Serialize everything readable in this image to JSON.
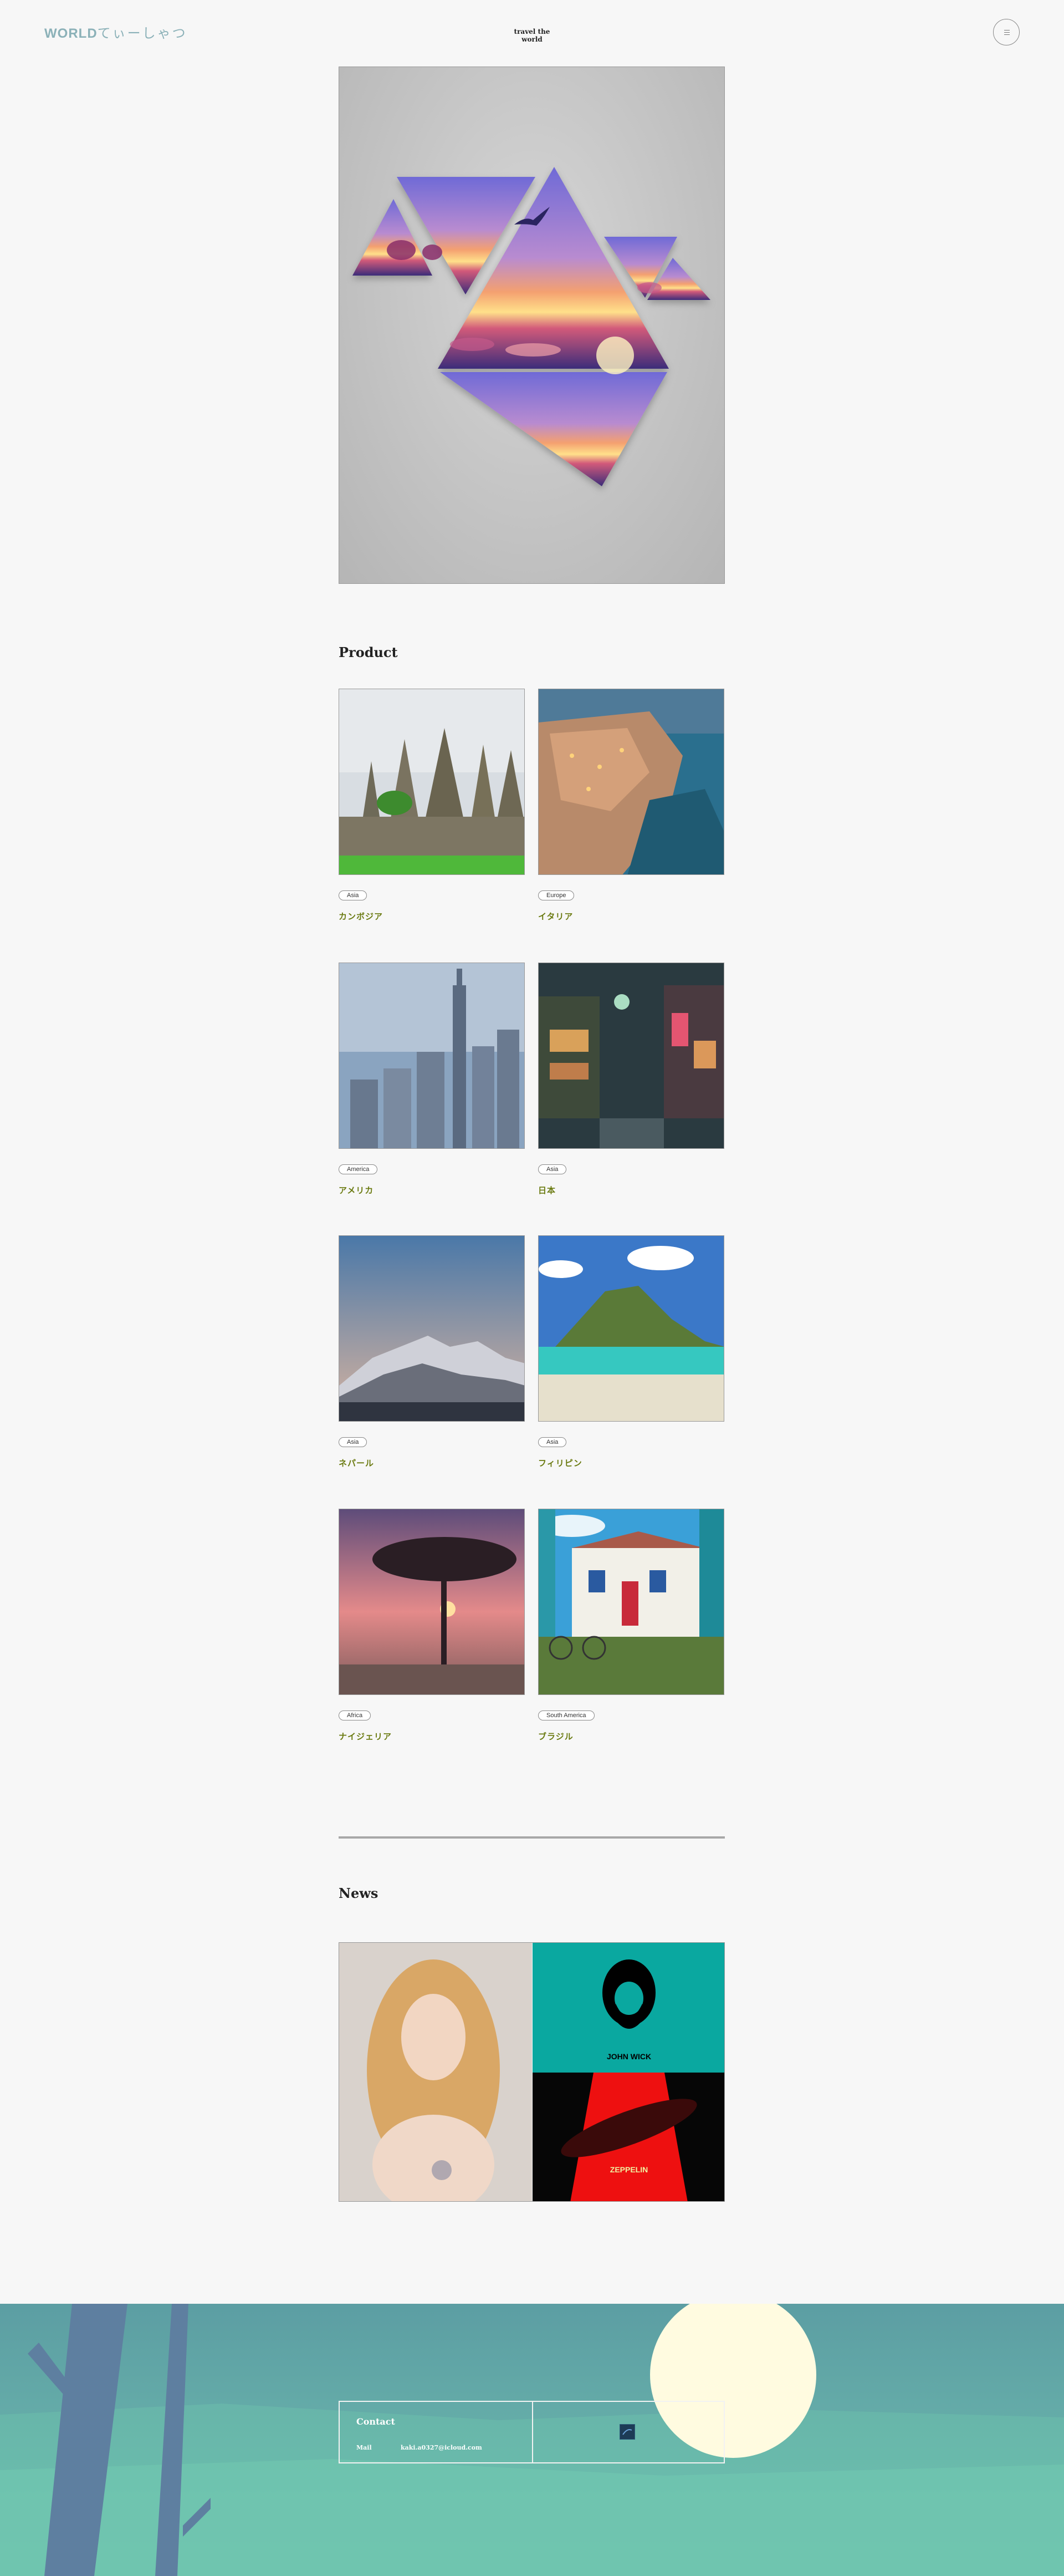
{
  "header": {
    "logo_strong": "WORLD",
    "logo_light": "てぃーしゃつ",
    "tagline": "travel the world"
  },
  "sections": {
    "product_title": "Product",
    "news_title": "News"
  },
  "products": [
    {
      "region": "Asia",
      "name": "カンボジア"
    },
    {
      "region": "Europe",
      "name": "イタリア"
    },
    {
      "region": "America",
      "name": "アメリカ"
    },
    {
      "region": "Asia",
      "name": "日本"
    },
    {
      "region": "Asia",
      "name": "ネパール"
    },
    {
      "region": "Asia",
      "name": "フィリピン"
    },
    {
      "region": "Africa",
      "name": "ナイジェリア"
    },
    {
      "region": "South America",
      "name": "ブラジル"
    }
  ],
  "news": {
    "poster_top_text": "JOHN WICK",
    "poster_bottom_text": "ZEPPELIN"
  },
  "footer": {
    "contact_title": "Contact",
    "mail_label": "Mail",
    "mail_value": "kaki.a0327@icloud.com"
  },
  "colors": {
    "logo": "#8bb1b8",
    "product_name": "#6a7a10",
    "footer_bg": "#64aba8",
    "news_teal": "#0aa8a0"
  }
}
